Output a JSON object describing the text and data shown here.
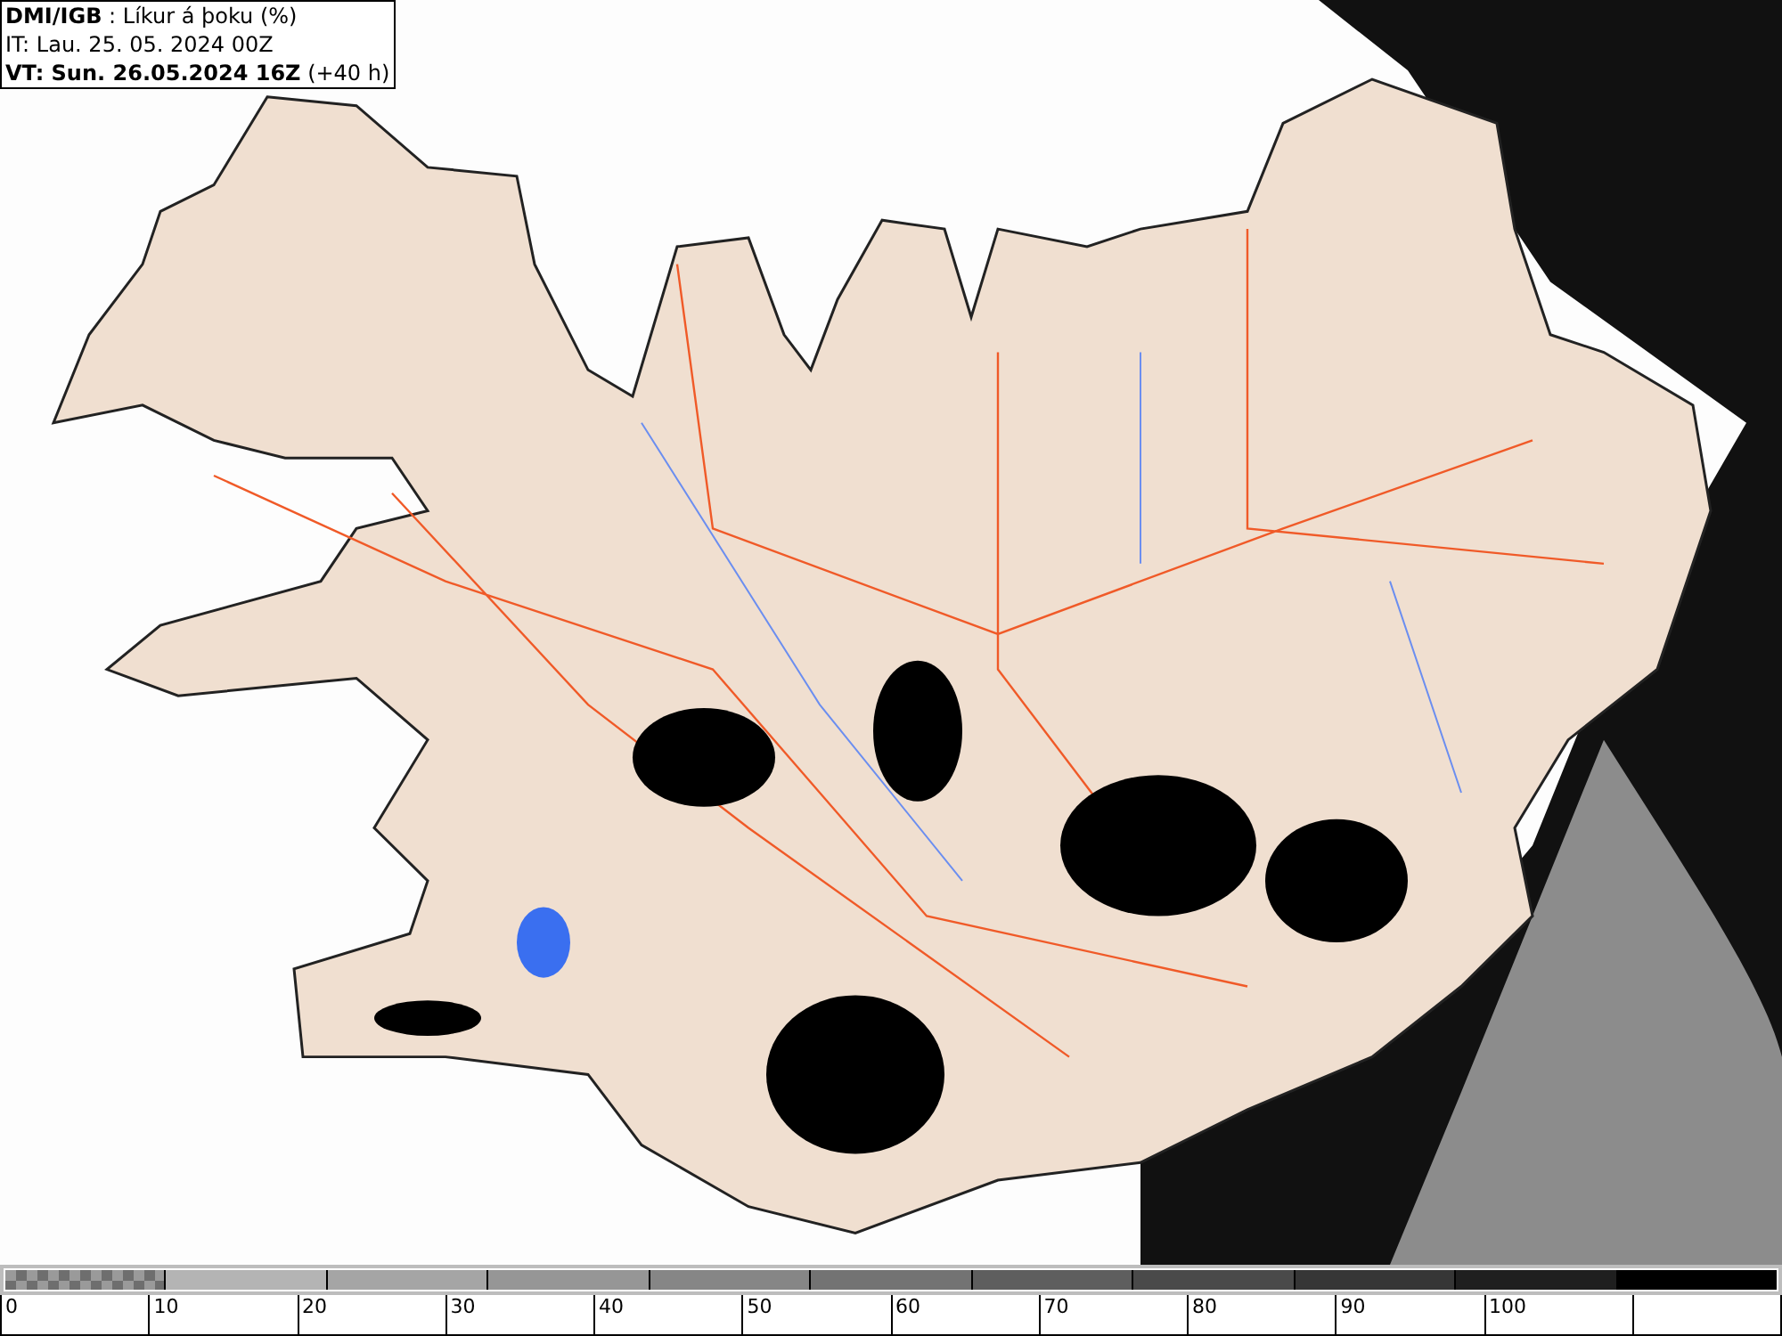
{
  "header": {
    "lines": [
      "**DMI/IGB** : Líkur á þoku (%)",
      "IT: Lau. 25. 05. 2024 00Z",
      "**VT: Sun. 26.05.2024 16Z** (+40 h)"
    ]
  },
  "legend": {
    "segments": [
      {
        "kind": "checker",
        "color": "#9a9a9a"
      },
      {
        "kind": "solid",
        "color": "#b4b4b4"
      },
      {
        "kind": "solid",
        "color": "#a5a5a5"
      },
      {
        "kind": "solid",
        "color": "#969696"
      },
      {
        "kind": "solid",
        "color": "#868686"
      },
      {
        "kind": "solid",
        "color": "#737373"
      },
      {
        "kind": "solid",
        "color": "#5e5e5e"
      },
      {
        "kind": "solid",
        "color": "#4a4a4a"
      },
      {
        "kind": "solid",
        "color": "#363636"
      },
      {
        "kind": "solid",
        "color": "#1f1f1f"
      },
      {
        "kind": "solid",
        "color": "#000000"
      }
    ],
    "labels": [
      "0",
      "10",
      "20",
      "30",
      "40",
      "50",
      "60",
      "70",
      "80",
      "90",
      "100"
    ]
  }
}
